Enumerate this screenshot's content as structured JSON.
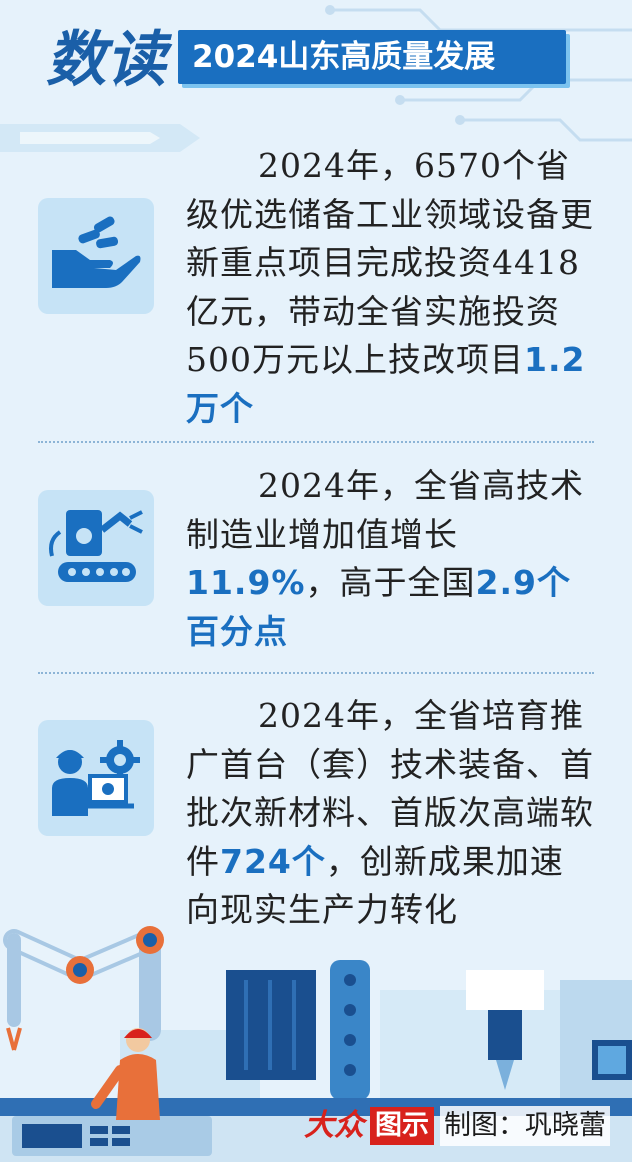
{
  "header": {
    "calligraphy": "数读",
    "title": "2024山东高质量发展"
  },
  "colors": {
    "accent": "#1a6fc0",
    "icon_bg": "#c6e3f6",
    "page_bg": "#e6f2fb",
    "logo_red": "#d8221c"
  },
  "sections": [
    {
      "icon": "hand-coins-icon",
      "text_before": "2024年，6570个省级优选储备工业领域设备更新重点项目完成投资4418亿元，带动全省实施投资500万元以上技改项目",
      "highlight": "1.2万个",
      "text_after": ""
    },
    {
      "icon": "robot-arm-icon",
      "text_before": "2024年，全省高技术制造业增加值增长",
      "highlight": "11.9%",
      "text_mid": "，高于全国",
      "highlight2": "2.9个百分点"
    },
    {
      "icon": "engineer-laptop-icon",
      "text_before": "2024年，全省培育推广首台（套）技术装备、首批次新材料、首版次高端软件",
      "highlight": "724个",
      "text_after": "，创新成果加速向现实生产力转化"
    }
  ],
  "credit": {
    "logo_script": "大众",
    "logo_box": "图示",
    "author": "制图：巩晓蕾"
  }
}
